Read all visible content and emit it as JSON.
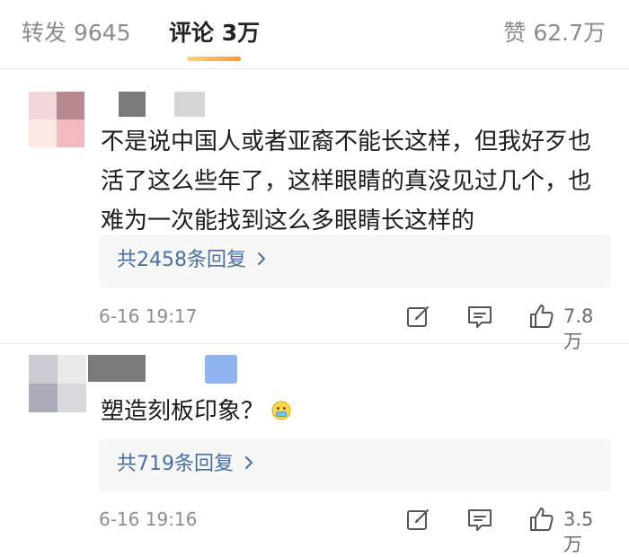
{
  "tabs": {
    "repost_label": "转发 9645",
    "comments_label": "评论 3万",
    "likes_label": "赞 62.7万"
  },
  "comments": [
    {
      "text_lines": [
        "不是说中国人或者亚裔不能长这样，但我好歹也",
        "活了这么些年了，这样眼睛的真没见过几个，也",
        "难为一次能找到这么多眼睛长这样的"
      ],
      "replies_label": "共2458条回复",
      "timestamp": "6-16 19:17",
      "like_count": "7.8万"
    },
    {
      "text_lines": [
        "塑造刻板印象？"
      ],
      "emoji": "grimace-emoji-icon",
      "replies_label": "共719条回复",
      "timestamp": "6-16 19:16",
      "like_count": "3.5万"
    }
  ],
  "icons": {
    "repost": "edit-square-icon",
    "reply": "comment-bubble-icon",
    "like": "thumbs-up-icon",
    "more": "chevron-right-icon"
  },
  "colors": {
    "tab_indicator": "#ffb347",
    "link": "#4a6fa5",
    "muted_text": "#8e8e8e",
    "reply_box_bg": "#f7f7f7"
  }
}
